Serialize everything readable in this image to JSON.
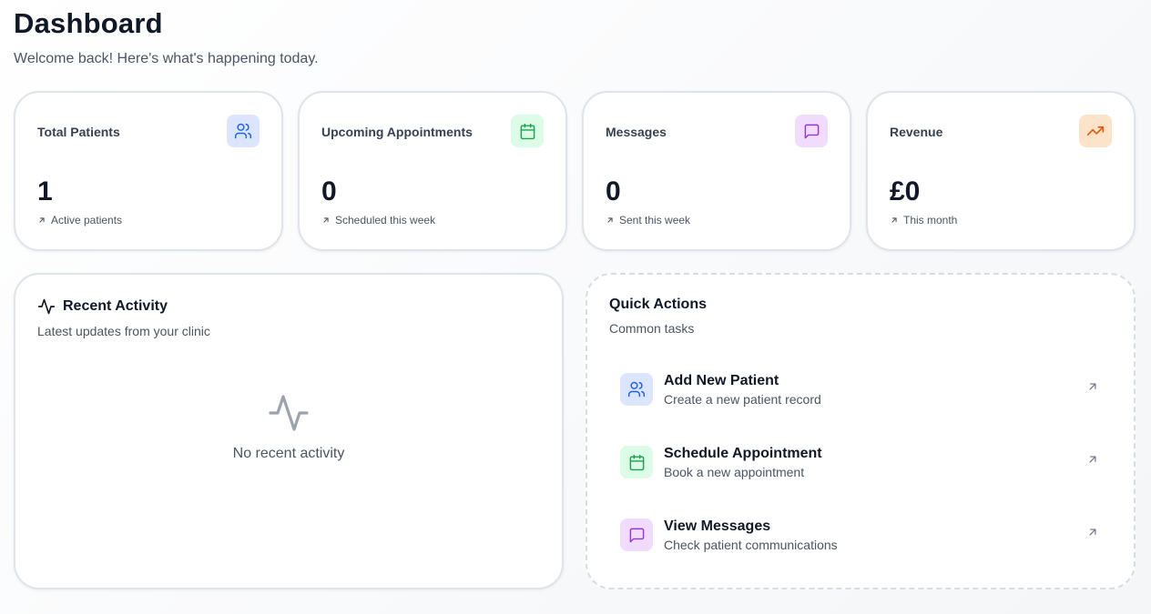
{
  "header": {
    "title": "Dashboard",
    "subtitle": "Welcome back! Here's what's happening today."
  },
  "stats": [
    {
      "title": "Total Patients",
      "value": "1",
      "sub": "Active patients",
      "icon": "users-icon",
      "color": "#2563eb"
    },
    {
      "title": "Upcoming Appointments",
      "value": "0",
      "sub": "Scheduled this week",
      "icon": "calendar-icon",
      "color": "#16a34a"
    },
    {
      "title": "Messages",
      "value": "0",
      "sub": "Sent this week",
      "icon": "message-icon",
      "color": "#9333ea"
    },
    {
      "title": "Revenue",
      "value": "£0",
      "sub": "This month",
      "icon": "trending-up-icon",
      "color": "#ea580c"
    }
  ],
  "recent_activity": {
    "title": "Recent Activity",
    "subtitle": "Latest updates from your clinic",
    "icon": "activity-icon",
    "empty_text": "No recent activity"
  },
  "quick_actions": {
    "title": "Quick Actions",
    "subtitle": "Common tasks",
    "items": [
      {
        "title": "Add New Patient",
        "desc": "Create a new patient record",
        "icon": "users-icon",
        "color": "#2563eb"
      },
      {
        "title": "Schedule Appointment",
        "desc": "Book a new appointment",
        "icon": "calendar-icon",
        "color": "#16a34a"
      },
      {
        "title": "View Messages",
        "desc": "Check patient communications",
        "icon": "message-icon",
        "color": "#9333ea"
      }
    ]
  }
}
